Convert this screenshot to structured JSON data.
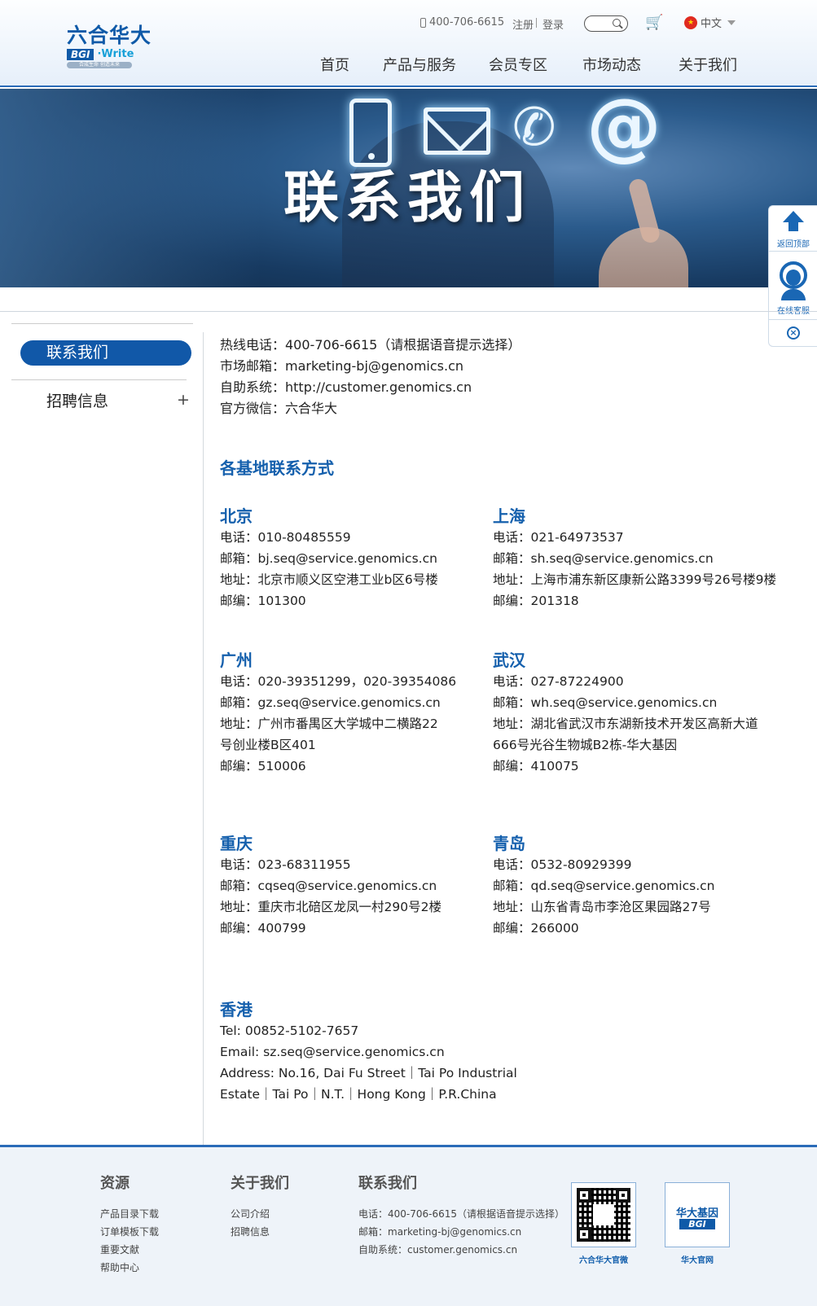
{
  "header": {
    "logo": {
      "cn": "六合华大",
      "bgi": "BGI",
      "write": "·Write",
      "slogan": "合成生命 创造未来"
    },
    "phone": "400-706-6615",
    "register": "注册",
    "login": "登录",
    "language": "中文",
    "nav": [
      "首页",
      "产品与服务",
      "会员专区",
      "市场动态",
      "关于我们"
    ]
  },
  "banner": {
    "title": "联系我们"
  },
  "float": {
    "top_label": "返回顶部",
    "cs_label": "在线客服"
  },
  "sidebar": {
    "active": "联系我们",
    "item": "招聘信息",
    "expand": "+"
  },
  "contact": {
    "hotline": "热线电话：400-706-6615（请根据语音提示选择）",
    "email": "市场邮箱：marketing-bj@genomics.cn",
    "self_service": "自助系统：http://customer.genomics.cn",
    "wechat": "官方微信：六合华大"
  },
  "bases_title": "各基地联系方式",
  "bases": {
    "beijing": {
      "name": "北京",
      "lines": [
        "电话：010-80485559",
        "邮箱：bj.seq@service.genomics.cn",
        "地址：北京市顺义区空港工业b区6号楼",
        "邮编：101300"
      ]
    },
    "shanghai": {
      "name": "上海",
      "lines": [
        "电话：021-64973537",
        "邮箱：sh.seq@service.genomics.cn",
        "地址：上海市浦东新区康新公路3399号26号楼9楼",
        "邮编：201318"
      ]
    },
    "guangzhou": {
      "name": "广州",
      "lines": [
        "电话：020-39351299，020-39354086",
        "邮箱：gz.seq@service.genomics.cn",
        "地址：广州市番禺区大学城中二横路22",
        "号创业楼B区401",
        "邮编：510006"
      ]
    },
    "wuhan": {
      "name": "武汉",
      "lines": [
        "电话：027-87224900",
        "邮箱：wh.seq@service.genomics.cn",
        "地址：湖北省武汉市东湖新技术开发区高新大道",
        "666号光谷生物城B2栋-华大基因",
        "邮编：410075"
      ]
    },
    "chongqing": {
      "name": "重庆",
      "lines": [
        "电话：023-68311955",
        "邮箱：cqseq@service.genomics.cn",
        "地址：重庆市北碚区龙凤一村290号2楼",
        "邮编：400799"
      ]
    },
    "qingdao": {
      "name": "青岛",
      "lines": [
        "电话：0532-80929399",
        "邮箱：qd.seq@service.genomics.cn",
        "地址：山东省青岛市李沧区果园路27号",
        "邮编：266000"
      ]
    },
    "hongkong": {
      "name": "香港",
      "lines": [
        "Tel: 00852-5102-7657",
        "Email:   sz.seq@service.genomics.cn",
        "Address: No.16, Dai Fu Street｜Tai Po Industrial",
        "Estate｜Tai Po｜N.T.｜Hong Kong｜P.R.China"
      ]
    }
  },
  "footer": {
    "resources": {
      "title": "资源",
      "links": [
        "产品目录下载",
        "订单模板下载",
        "重要文献",
        "帮助中心"
      ]
    },
    "about": {
      "title": "关于我们",
      "links": [
        "公司介绍",
        "招聘信息"
      ]
    },
    "contact": {
      "title": "联系我们",
      "lines": [
        "电话：400-706-6615（请根据语音提示选择）",
        "邮箱：marketing-bj@genomics.cn",
        "自助系统：customer.genomics.cn"
      ]
    },
    "qr1_caption": "六合华大官微",
    "qr2_caption": "华大官网",
    "bgi_cn": "华大基因",
    "bgi_en": "BGI"
  },
  "icons": [
    "mobile-phone-icon",
    "search-icon",
    "cart-icon",
    "china-flag-icon",
    "caret-down-icon",
    "back-to-top-icon",
    "customer-service-icon",
    "close-circle-icon",
    "plus-icon",
    "phone-glyph-icon",
    "mail-glyph-icon",
    "at-glyph-icon"
  ],
  "colors": {
    "brand": "#1158a8",
    "title_blue": "#1560ad",
    "footer_bg": "#eef3f9"
  }
}
